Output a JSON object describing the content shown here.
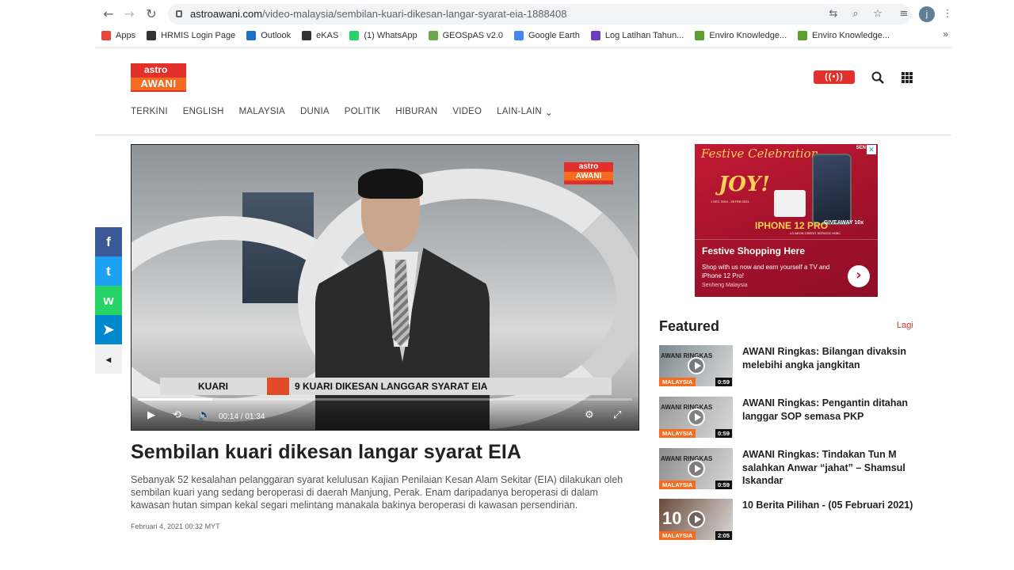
{
  "browser": {
    "url_host": "astroawani.com",
    "url_path": "/video-malaysia/sembilan-kuari-dikesan-langar-syarat-eia-1888408",
    "avatar_letter": "j",
    "bookmarks": [
      {
        "label": "Apps",
        "color": "#e8453c"
      },
      {
        "label": "HRMIS Login Page",
        "color": "#333333"
      },
      {
        "label": "Outlook",
        "color": "#1a73c8"
      },
      {
        "label": "eKAS",
        "color": "#333333"
      },
      {
        "label": "(1) WhatsApp",
        "color": "#25d366"
      },
      {
        "label": "GEOSpAS v2.0",
        "color": "#6aa84f"
      },
      {
        "label": "Google Earth",
        "color": "#4285f4"
      },
      {
        "label": "Log Latihan Tahun...",
        "color": "#6f3cbf"
      },
      {
        "label": "Enviro Knowledge...",
        "color": "#5aa02c"
      },
      {
        "label": "Enviro Knowledge...",
        "color": "#5aa02c"
      }
    ],
    "bookmarks_more": "»"
  },
  "site": {
    "logo_top": "astro",
    "logo_bottom": "AWANI",
    "live_label": "LIVE",
    "nav": [
      "TERKINI",
      "ENGLISH",
      "MALAYSIA",
      "DUNIA",
      "POLITIK",
      "HIBURAN",
      "VIDEO",
      "LAIN-LAIN"
    ]
  },
  "social": [
    {
      "icon": "facebook-icon",
      "glyph": "f",
      "color": "#3b5998"
    },
    {
      "icon": "twitter-icon",
      "glyph": "t",
      "color": "#1da1f2"
    },
    {
      "icon": "whatsapp-icon",
      "glyph": "w",
      "color": "#25d366"
    },
    {
      "icon": "telegram-icon",
      "glyph": "➤",
      "color": "#0088cc"
    },
    {
      "icon": "collapse-icon",
      "glyph": "◂",
      "color": "#f1f1f1"
    }
  ],
  "video": {
    "logo_top": "astro",
    "logo_bottom": "AWANI",
    "lower_tag": "KUARI",
    "lower_headline": "9 KUARI DIKESAN LANGGAR SYARAT EIA",
    "current_time": "00:14",
    "separator": "/",
    "duration": "01:34",
    "progress": 0.15
  },
  "article": {
    "title": "Sembilan kuari dikesan langar syarat EIA",
    "summary": "Sebanyak 52 kesalahan pelanggaran syarat kelulusan Kajian Penilaian Kesan Alam Sekitar (EIA) dilakukan oleh sembilan kuari yang sedang beroperasi di daerah Manjung, Perak. Enam daripadanya beroperasi di dalam kawasan hutan simpan kekal segari melintang manakala bakinya beroperasi di kawasan persendirian.",
    "date": "Februari 4, 2021 00:32 MYT"
  },
  "ad": {
    "festive": "Festive Celebration",
    "joy": "JOY!",
    "dates": "1 DEC 2020 - 28 FEB 2021",
    "product": "IPHONE 12 PRO",
    "giveaway": "GIVEAWAY 10x",
    "partners": "LG  AEON CREDIT SERVICE  HSBC",
    "brand_tag": "SEN",
    "close": "✕",
    "headline": "Festive Shopping Here",
    "body": "Shop with us now and earn yourself a TV and iPhone 12 Pro!",
    "sponsor": "Senheng Malaysia"
  },
  "featured": {
    "heading": "Featured",
    "more": "Lagi",
    "items": [
      {
        "title": "AWANI Ringkas: Bilangan divaksin melebihi angka jangkitan",
        "tag": "MALAYSIA",
        "duration": "0:59",
        "thumb_text": "AWANI RINGKAS",
        "thumb_color": "#7d8a8f"
      },
      {
        "title": "AWANI Ringkas: Pengantin ditahan langgar SOP semasa PKP",
        "tag": "MALAYSIA",
        "duration": "0:59",
        "thumb_text": "AWANI RINGKAS",
        "thumb_color": "#9a9a9a"
      },
      {
        "title": "AWANI Ringkas: Tindakan Tun M salahkan Anwar “jahat” – Shamsul Iskandar",
        "tag": "MALAYSIA",
        "duration": "0:59",
        "thumb_text": "AWANI RINGKAS",
        "thumb_color": "#8c8c8c"
      },
      {
        "title": "10 Berita Pilihan - (05 Februari 2021)",
        "tag": "MALAYSIA",
        "duration": "2:05",
        "thumb_text": "10",
        "thumb_color": "#6b4a3a"
      }
    ]
  }
}
